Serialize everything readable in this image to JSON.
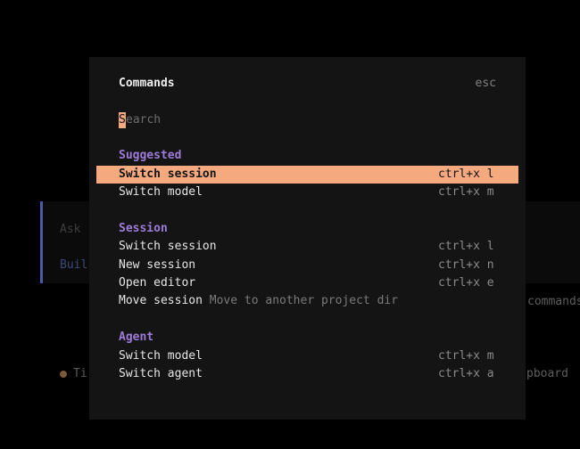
{
  "background": {
    "prompt_line1": "Ask",
    "prompt_line2": "Buil",
    "hint_right": "commands",
    "tip_left": "Ti",
    "tip_right": "pboard",
    "accent_color": "#4a5aa6"
  },
  "palette": {
    "title": "Commands",
    "close_hint": "esc",
    "search": {
      "placeholder": "Search",
      "placeholder_first": "S",
      "placeholder_rest": "earch"
    },
    "sections": [
      {
        "title": "Suggested",
        "items": [
          {
            "label": "Switch session",
            "shortcut": "ctrl+x l",
            "selected": true
          },
          {
            "label": "Switch model",
            "shortcut": "ctrl+x m"
          }
        ]
      },
      {
        "title": "Session",
        "items": [
          {
            "label": "Switch session",
            "shortcut": "ctrl+x l"
          },
          {
            "label": "New session",
            "shortcut": "ctrl+x n"
          },
          {
            "label": "Open editor",
            "shortcut": "ctrl+x e"
          },
          {
            "label": "Move session",
            "description": "Move to another project dir"
          }
        ]
      },
      {
        "title": "Agent",
        "items": [
          {
            "label": "Switch model",
            "shortcut": "ctrl+x m"
          },
          {
            "label": "Switch agent",
            "shortcut": "ctrl+x a"
          }
        ]
      }
    ],
    "colors": {
      "highlight": "#f5a97f",
      "section_title": "#9d7cd8",
      "panel_bg": "#141414"
    }
  }
}
